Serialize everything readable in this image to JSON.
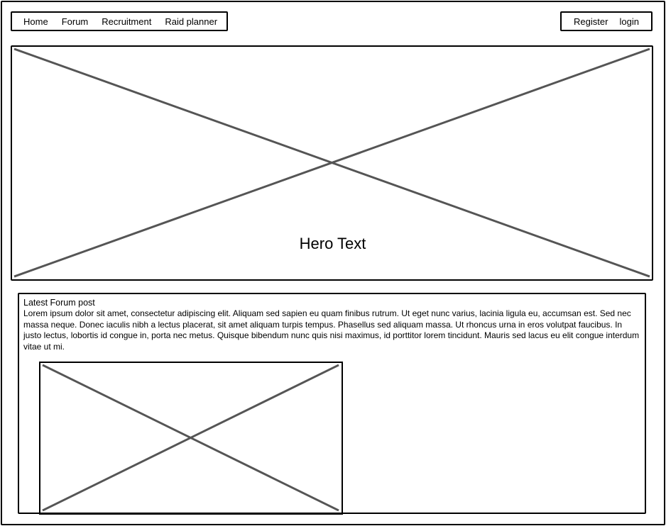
{
  "nav": {
    "left_links": [
      "Home",
      "Forum",
      "Recruitment",
      "Raid planner"
    ],
    "right_links": [
      "Register",
      "login"
    ]
  },
  "hero": {
    "text": "Hero Text",
    "image_placeholder": "image-placeholder"
  },
  "latest_post": {
    "title": "Latest Forum post",
    "body": "Lorem ipsum dolor sit amet, consectetur adipiscing elit. Aliquam sed sapien eu quam finibus rutrum. Ut eget nunc varius, lacinia ligula eu, accumsan est. Sed nec massa neque. Donec iaculis nibh a lectus placerat, sit amet aliquam turpis tempus. Phasellus sed aliquam massa. Ut rhoncus urna in eros volutpat faucibus. In justo lectus, lobortis id congue in, porta nec metus. Quisque bibendum nunc quis nisi maximus, id porttitor lorem tincidunt. Mauris sed lacus eu elit congue interdum vitae ut mi.",
    "image_placeholder": "image-placeholder"
  },
  "colors": {
    "stroke": "#000000",
    "placeholder_cross": "#555555",
    "background": "#ffffff"
  }
}
